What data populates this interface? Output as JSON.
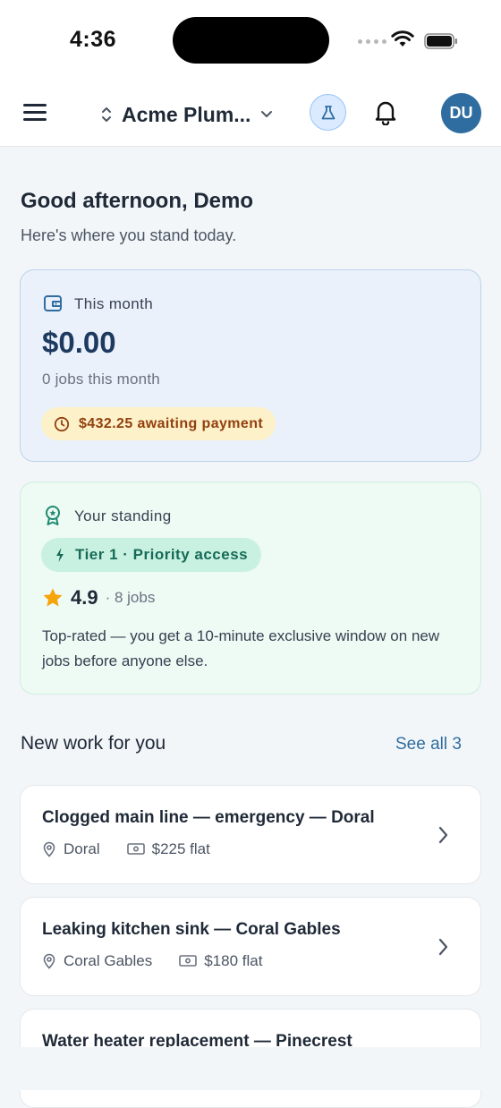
{
  "status_bar": {
    "time": "4:36"
  },
  "header": {
    "org_name": "Acme Plum...",
    "avatar_initials": "DU"
  },
  "greeting": {
    "title": "Good afternoon, Demo",
    "subtitle": "Here's where you stand today."
  },
  "earnings": {
    "label": "This month",
    "amount": "$0.00",
    "jobs_count": "0 jobs this month",
    "pending": "$432.25 awaiting payment"
  },
  "standing": {
    "label": "Your standing",
    "tier": "Tier 1 · Priority access",
    "rating": "4.9",
    "rating_jobs": "· 8 jobs",
    "description": "Top-rated — you get a 10-minute exclusive window on new jobs before anyone else."
  },
  "new_work": {
    "title": "New work for you",
    "see_all": "See all 3",
    "jobs": [
      {
        "title": "Clogged main line — emergency — Doral",
        "location": "Doral",
        "price": "$225 flat"
      },
      {
        "title": "Leaking kitchen sink — Coral Gables",
        "location": "Coral Gables",
        "price": "$180 flat"
      },
      {
        "title": "Water heater replacement — Pinecrest"
      }
    ]
  },
  "colors": {
    "accent": "#2f6da0",
    "amount": "#1e3a5f",
    "pending_bg": "#fdf1c9",
    "tier_bg": "#c9f1e1"
  }
}
